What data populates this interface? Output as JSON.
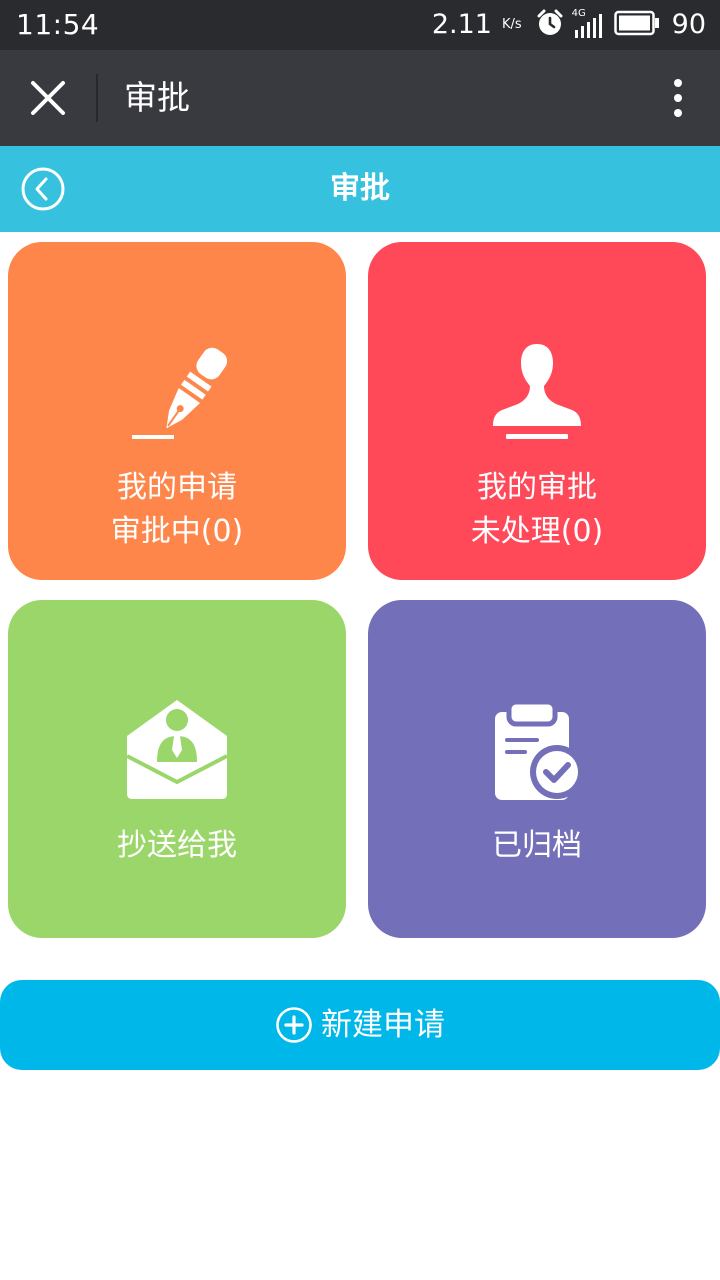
{
  "status_bar": {
    "time": "11:54",
    "net_speed": "2.11",
    "net_speed_unit": "K/s",
    "network_type": "4G",
    "battery": "90",
    "icons": [
      "alarm-icon",
      "signal-icon",
      "battery-icon"
    ]
  },
  "title_bar": {
    "title": "审批",
    "close_icon": "close-icon",
    "more_icon": "more-vertical-icon"
  },
  "header": {
    "title": "审批",
    "back_icon": "back-circle-icon"
  },
  "tiles": [
    {
      "line1": "我的申请",
      "line2": "审批中(0)",
      "icon": "pen-icon",
      "color": "#ff864a"
    },
    {
      "line1": "我的审批",
      "line2": "未处理(0)",
      "icon": "stamp-icon",
      "color": "#ff4858"
    },
    {
      "line1": "抄送给我",
      "icon": "envelope-person-icon",
      "color": "#9bd66b"
    },
    {
      "line1": "已归档",
      "icon": "clipboard-check-icon",
      "color": "#746fb9"
    }
  ],
  "new_request": {
    "label": "新建申请",
    "icon": "plus-circle-icon",
    "color": "#00b7ea"
  },
  "colors": {
    "status_bar_bg": "#2a2b2f",
    "title_bar_bg": "#393a3f",
    "header_bg": "#36c2df"
  }
}
